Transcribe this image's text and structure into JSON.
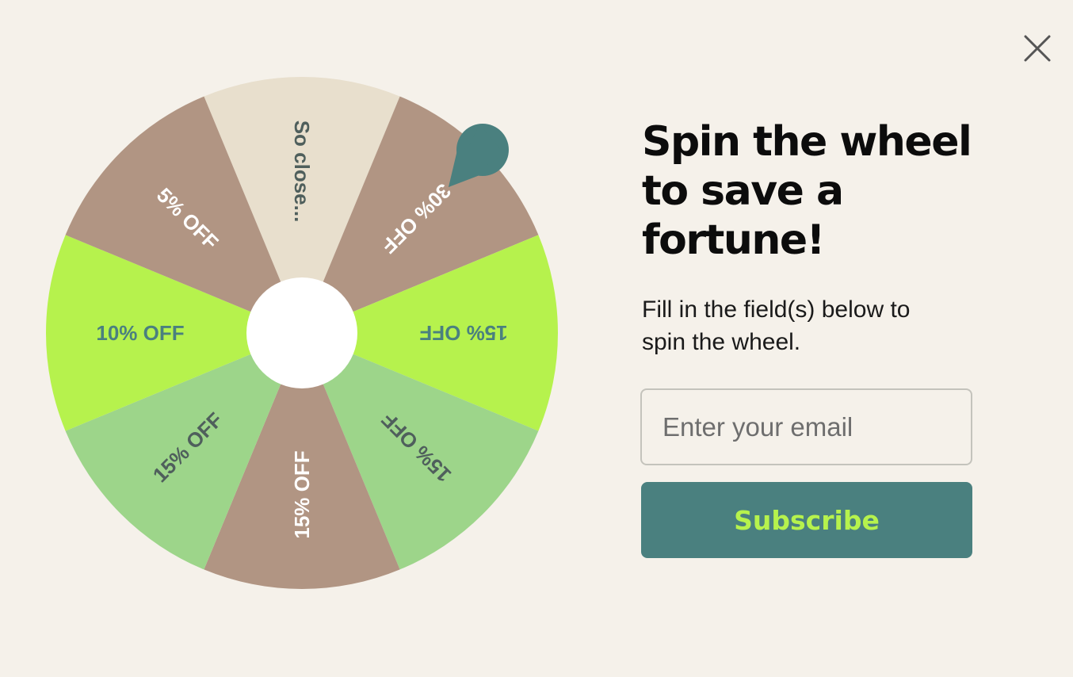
{
  "colors": {
    "background": "#f5f1ea",
    "segment_brown": "#b19583",
    "segment_cream": "#e8dfcd",
    "segment_lime": "#b6f24d",
    "segment_light_green": "#9dd58a",
    "accent_teal": "#4a807f",
    "hub": "#ffffff",
    "button_text": "#b6f24d"
  },
  "close": {
    "icon": "close-x-icon"
  },
  "wheel": {
    "segments": [
      {
        "label": "So close...",
        "fill": "#e8dfcd",
        "text_color": "#4f5f5c"
      },
      {
        "label": "30% OFF",
        "fill": "#b19583",
        "text_color": "#ffffff"
      },
      {
        "label": "15% OFF",
        "fill": "#b6f24d",
        "text_color": "#4a807f"
      },
      {
        "label": "15% OFF",
        "fill": "#9dd58a",
        "text_color": "#4f5f5c"
      },
      {
        "label": "15% OFF",
        "fill": "#b19583",
        "text_color": "#ffffff"
      },
      {
        "label": "15% OFF",
        "fill": "#9dd58a",
        "text_color": "#4f5f5c"
      },
      {
        "label": "10% OFF",
        "fill": "#b6f24d",
        "text_color": "#4a807f"
      },
      {
        "label": "5% OFF",
        "fill": "#b19583",
        "text_color": "#ffffff"
      }
    ],
    "pointer_icon": "teardrop-pointer-icon"
  },
  "content": {
    "headline": "Spin the wheel to save a fortune!",
    "subtitle": "Fill in the field(s) below to spin the wheel."
  },
  "form": {
    "email_placeholder": "Enter your email",
    "email_value": "",
    "subscribe_label": "Subscribe"
  }
}
